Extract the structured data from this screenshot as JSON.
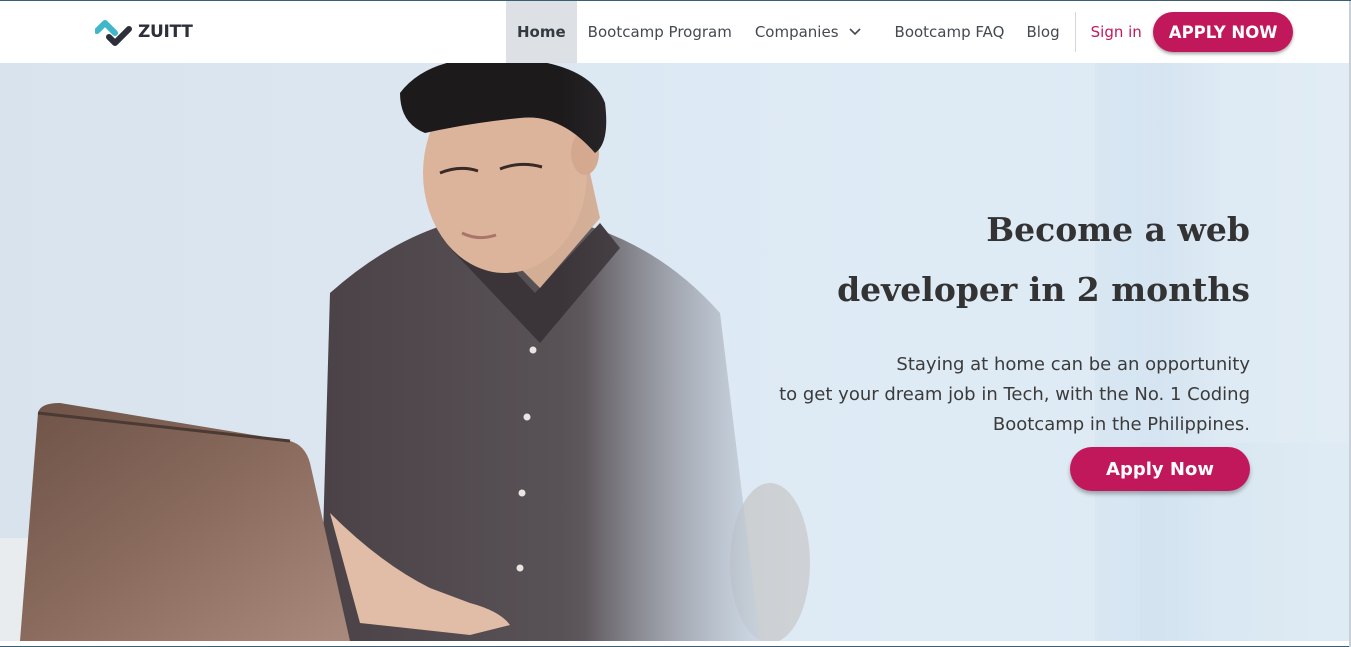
{
  "brand": {
    "name": "ZUITT",
    "logo_icon": "zuitt-logo-icon",
    "accent_color": "#c1185b"
  },
  "nav": {
    "items": [
      {
        "label": "Home",
        "active": true
      },
      {
        "label": "Bootcamp Program",
        "active": false
      },
      {
        "label": "Companies",
        "active": false,
        "has_dropdown": true
      },
      {
        "label": "Bootcamp FAQ",
        "active": false
      },
      {
        "label": "Blog",
        "active": false
      }
    ],
    "sign_in": "Sign in",
    "apply_button": "APPLY NOW"
  },
  "hero": {
    "title_line1": "Become a web",
    "title_line2": "developer in 2 months",
    "subtitle_line1": "Staying at home can be an opportunity",
    "subtitle_line2": "to get your dream job in Tech, with the No. 1 Coding",
    "subtitle_line3": "Bootcamp in the Philippines.",
    "cta_button": "Apply Now",
    "image_subject": "hero-photo"
  }
}
